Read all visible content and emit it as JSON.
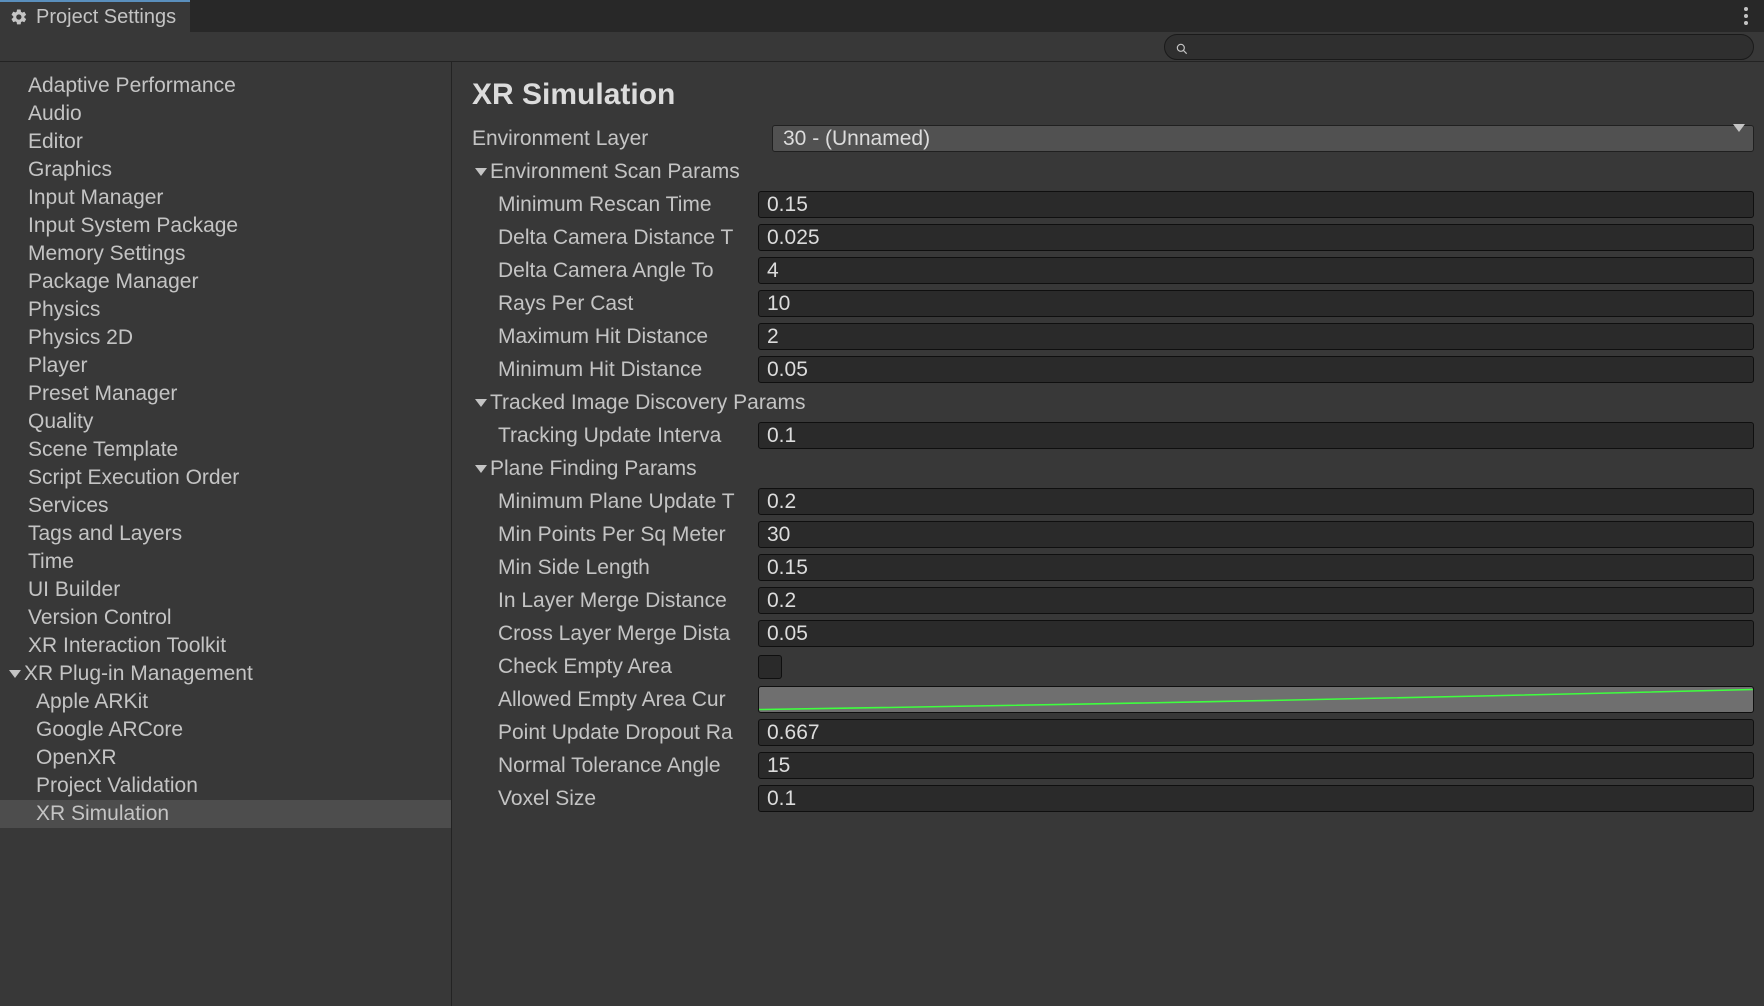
{
  "window": {
    "title": "Project Settings"
  },
  "search": {
    "placeholder": ""
  },
  "sidebar": {
    "items": [
      {
        "label": "Adaptive Performance",
        "depth": 0
      },
      {
        "label": "Audio",
        "depth": 0
      },
      {
        "label": "Editor",
        "depth": 0
      },
      {
        "label": "Graphics",
        "depth": 0
      },
      {
        "label": "Input Manager",
        "depth": 0
      },
      {
        "label": "Input System Package",
        "depth": 0
      },
      {
        "label": "Memory Settings",
        "depth": 0
      },
      {
        "label": "Package Manager",
        "depth": 0
      },
      {
        "label": "Physics",
        "depth": 0
      },
      {
        "label": "Physics 2D",
        "depth": 0
      },
      {
        "label": "Player",
        "depth": 0
      },
      {
        "label": "Preset Manager",
        "depth": 0
      },
      {
        "label": "Quality",
        "depth": 0
      },
      {
        "label": "Scene Template",
        "depth": 0
      },
      {
        "label": "Script Execution Order",
        "depth": 0
      },
      {
        "label": "Services",
        "depth": 0
      },
      {
        "label": "Tags and Layers",
        "depth": 0
      },
      {
        "label": "Time",
        "depth": 0
      },
      {
        "label": "UI Builder",
        "depth": 0
      },
      {
        "label": "Version Control",
        "depth": 0
      },
      {
        "label": "XR Interaction Toolkit",
        "depth": 0
      },
      {
        "label": "XR Plug-in Management",
        "depth": 0,
        "expandable": true,
        "expanded": true
      },
      {
        "label": "Apple ARKit",
        "depth": 1
      },
      {
        "label": "Google ARCore",
        "depth": 1
      },
      {
        "label": "OpenXR",
        "depth": 1
      },
      {
        "label": "Project Validation",
        "depth": 1
      },
      {
        "label": "XR Simulation",
        "depth": 1,
        "selected": true
      }
    ]
  },
  "content": {
    "title": "XR Simulation",
    "env_layer": {
      "label": "Environment Layer",
      "value": "30 - (Unnamed)"
    },
    "sections": {
      "env_scan": {
        "label": "Environment Scan Params",
        "fields": [
          {
            "label": "Minimum Rescan Time",
            "value": "0.15"
          },
          {
            "label": "Delta Camera Distance T",
            "value": "0.025"
          },
          {
            "label": "Delta Camera Angle To",
            "value": "4"
          },
          {
            "label": "Rays Per Cast",
            "value": "10"
          },
          {
            "label": "Maximum Hit Distance",
            "value": "2"
          },
          {
            "label": "Minimum Hit Distance",
            "value": "0.05"
          }
        ]
      },
      "tracked_image": {
        "label": "Tracked Image Discovery Params",
        "fields": [
          {
            "label": "Tracking Update Interva",
            "value": "0.1"
          }
        ]
      },
      "plane_finding": {
        "label": "Plane Finding Params",
        "fields": [
          {
            "label": "Minimum Plane Update T",
            "value": "0.2"
          },
          {
            "label": "Min Points Per Sq Meter",
            "value": "30"
          },
          {
            "label": "Min Side Length",
            "value": "0.15"
          },
          {
            "label": "In Layer Merge Distance",
            "value": "0.2"
          },
          {
            "label": "Cross Layer Merge Dista",
            "value": "0.05"
          },
          {
            "label": "Check Empty Area",
            "type": "checkbox",
            "value": false
          },
          {
            "label": "Allowed Empty Area Cur",
            "type": "curve"
          },
          {
            "label": "Point Update Dropout Ra",
            "value": "0.667"
          },
          {
            "label": "Normal Tolerance Angle",
            "value": "15"
          },
          {
            "label": "Voxel Size",
            "value": "0.1"
          }
        ]
      }
    }
  }
}
